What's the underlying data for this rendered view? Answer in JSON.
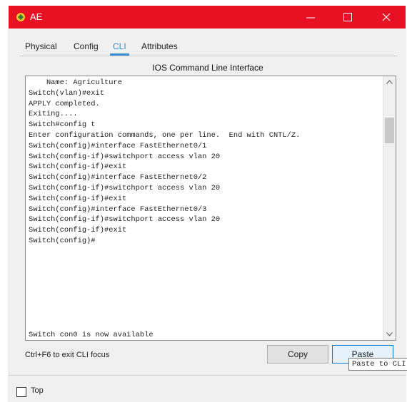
{
  "window": {
    "title": "AE",
    "colors": {
      "titlebar": "#e81123",
      "active_tab": "#3a8cd0"
    }
  },
  "tabs": [
    {
      "label": "Physical"
    },
    {
      "label": "Config"
    },
    {
      "label": "CLI",
      "active": true
    },
    {
      "label": "Attributes"
    }
  ],
  "panel": {
    "title": "IOS Command Line Interface"
  },
  "terminal": {
    "text": "    Name: Agriculture\nSwitch(vlan)#exit\nAPPLY completed.\nExiting....\nSwitch#config t\nEnter configuration commands, one per line.  End with CNTL/Z.\nSwitch(config)#interface FastEthernet0/1\nSwitch(config-if)#switchport access vlan 20\nSwitch(config-if)#exit\nSwitch(config)#interface FastEthernet0/2\nSwitch(config-if)#switchport access vlan 20\nSwitch(config-if)#exit\nSwitch(config)#interface FastEthernet0/3\nSwitch(config-if)#switchport access vlan 20\nSwitch(config-if)#exit\nSwitch(config)#",
    "status": "Switch con0 is now available"
  },
  "footer": {
    "hint": "Ctrl+F6 to exit CLI focus",
    "copy_label": "Copy",
    "paste_label": "Paste",
    "tooltip": "Paste to CLI"
  },
  "bottom": {
    "top_label": "Top",
    "top_checked": false
  }
}
